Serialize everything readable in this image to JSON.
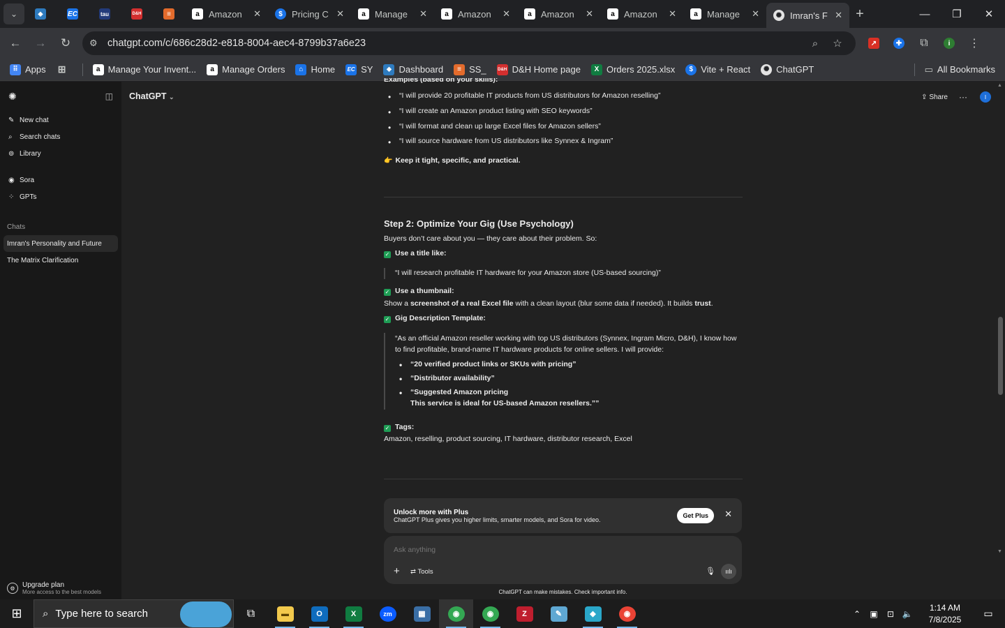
{
  "browser": {
    "tabs": [
      {
        "title": "Amazon",
        "icon": "amazon-icon"
      },
      {
        "title": "Pricing C",
        "icon": "dollar-icon"
      },
      {
        "title": "Manage",
        "icon": "amazon-icon"
      },
      {
        "title": "Amazon",
        "icon": "amazon-icon"
      },
      {
        "title": "Amazon",
        "icon": "amazon-icon"
      },
      {
        "title": "Amazon",
        "icon": "amazon-icon"
      },
      {
        "title": "Manage",
        "icon": "amazon-icon"
      },
      {
        "title": "Imran's F",
        "icon": "chatgpt-icon"
      }
    ],
    "pinned_tabs": [
      {
        "label": "",
        "icon": "ribbon-icon",
        "color": "#2e7bbf"
      },
      {
        "label": "EC",
        "icon": "ec-icon",
        "color": "#1a73e8"
      },
      {
        "label": "tau",
        "icon": "tau-icon",
        "color": "#233b7a"
      },
      {
        "label": "D&H",
        "icon": "dh-icon",
        "color": "#d32f2f"
      },
      {
        "label": "",
        "icon": "stack-icon",
        "color": "#e36b2c"
      }
    ],
    "url": "chatgpt.com/c/686c28d2-e818-8004-aec4-8799b37a6e23",
    "bookmarks": [
      {
        "label": "Apps",
        "icon": "apps-grid-icon"
      },
      {
        "label": "",
        "icon": "tab-groups-icon"
      },
      {
        "label": "Manage Your Invent...",
        "icon": "amazon-icon"
      },
      {
        "label": "Manage Orders",
        "icon": "amazon-icon"
      },
      {
        "label": "Home",
        "icon": "home-bookmark-icon"
      },
      {
        "label": "SY",
        "icon": "ec-icon"
      },
      {
        "label": "Dashboard",
        "icon": "dashboard-icon"
      },
      {
        "label": "SS_",
        "icon": "stack-icon"
      },
      {
        "label": "D&H Home page",
        "icon": "dh-icon"
      },
      {
        "label": "Orders 2025.xlsx",
        "icon": "excel-icon"
      },
      {
        "label": "Vite + React",
        "icon": "dollar-icon"
      },
      {
        "label": "ChatGPT",
        "icon": "chatgpt-icon"
      }
    ],
    "all_bookmarks": "All Bookmarks",
    "colors": {
      "tabstrip": "#202124",
      "toolbar": "#35363a"
    }
  },
  "sidebar": {
    "nav": [
      {
        "label": "New chat",
        "icon": "edit-icon"
      },
      {
        "label": "Search chats",
        "icon": "search-icon"
      },
      {
        "label": "Library",
        "icon": "library-icon"
      }
    ],
    "nav2": [
      {
        "label": "Sora",
        "icon": "play-icon"
      },
      {
        "label": "GPTs",
        "icon": "grid-icon"
      }
    ],
    "chats_heading": "Chats",
    "chats": [
      {
        "label": "Imran's Personality and Future",
        "active": true
      },
      {
        "label": "The Matrix Clarification",
        "active": false
      }
    ],
    "upgrade": {
      "title": "Upgrade plan",
      "subtitle": "More access to the best models"
    }
  },
  "header": {
    "model": "ChatGPT",
    "share": "Share",
    "avatar_initial": "I"
  },
  "content": {
    "cut_heading": "Examples (based on your skills):",
    "examples": [
      "“I will provide 20 profitable IT products from US distributors for Amazon reselling”",
      "“I will create an Amazon product listing with SEO keywords”",
      "“I will format and clean up large Excel files for Amazon sellers”",
      "“I will source hardware from US distributors like Synnex & Ingram”"
    ],
    "tip_icon": "👉",
    "tip_prefix": "Keep it ",
    "tip_bold": "tight, specific, and practical.",
    "step2_title": "Step 2: Optimize Your Gig (Use Psychology)",
    "step2_intro": "Buyers don’t care about you — they care about their problem. So:",
    "title_label": "Use a title like:",
    "title_quote": "“I will research profitable IT hardware for your Amazon store (US-based sourcing)”",
    "thumb_label": "Use a thumbnail:",
    "thumb_text_a": "Show a ",
    "thumb_text_b": "screenshot of a real Excel file",
    "thumb_text_c": " with a clean layout (blur some data if needed). It builds ",
    "thumb_text_d": "trust",
    "thumb_text_e": ".",
    "desc_label": "Gig Description Template:",
    "desc_quote": "“As an official Amazon reseller working with top US distributors (Synnex, Ingram Micro, D&H), I know how to find profitable, brand-name IT hardware products for online sellers. I will provide:",
    "desc_bullets": [
      "“20 verified product links or SKUs with pricing”",
      "“Distributor availability”",
      "“Suggested Amazon pricing"
    ],
    "desc_tail": "This service is ideal for US-based Amazon resellers.””",
    "tags_label": "Tags:",
    "tags": "Amazon, reselling, product sourcing, IT hardware, distributor research, Excel"
  },
  "plus_banner": {
    "title": "Unlock more with Plus",
    "subtitle": "ChatGPT Plus gives you higher limits, smarter models, and Sora for video.",
    "button": "Get Plus"
  },
  "composer": {
    "placeholder": "Ask anything",
    "tools": "Tools"
  },
  "disclaimer": "ChatGPT can make mistakes. Check important info.",
  "taskbar": {
    "search_placeholder": "Type here to search",
    "apps": [
      {
        "icon": "task-view-icon",
        "color": "#1c1c1c"
      },
      {
        "icon": "file-explorer-icon",
        "color": "#f2c94c"
      },
      {
        "icon": "outlook-icon",
        "color": "#0f6cbd"
      },
      {
        "icon": "excel-icon",
        "color": "#107c41"
      },
      {
        "icon": "zoom-icon",
        "color": "#0b5cff"
      },
      {
        "icon": "calculator-icon",
        "color": "#3a6ea5"
      },
      {
        "icon": "chrome-icon",
        "color": "#34a853"
      },
      {
        "icon": "chrome-icon",
        "color": "#34a853"
      },
      {
        "icon": "filezilla-icon",
        "color": "#bf1e2e"
      },
      {
        "icon": "notepad-icon",
        "color": "#5fa8d3"
      },
      {
        "icon": "app-diamond-icon",
        "color": "#2aa7c9"
      },
      {
        "icon": "chrome-profile-icon",
        "color": "#ea4335"
      }
    ],
    "time": "1:14 AM",
    "date": "7/8/2025"
  }
}
